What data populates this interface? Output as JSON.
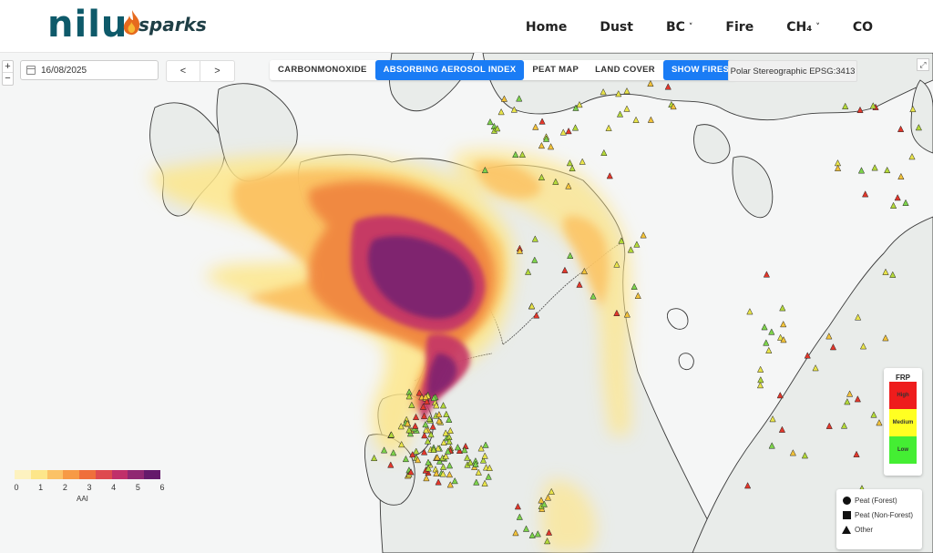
{
  "header": {
    "logo_main": "nilu",
    "logo_sub": "sparks",
    "nav": [
      {
        "label": "Home",
        "dropdown": false
      },
      {
        "label": "Dust",
        "dropdown": false
      },
      {
        "label": "BC",
        "dropdown": true
      },
      {
        "label": "Fire",
        "dropdown": false
      },
      {
        "label": "CH₄",
        "dropdown": true
      },
      {
        "label": "CO",
        "dropdown": false
      }
    ]
  },
  "controls": {
    "zoom_in": "+",
    "zoom_out": "−",
    "date_value": "16/08/2025",
    "prev_label": "<",
    "next_label": ">",
    "layers": [
      {
        "label": "CARBONMONOXIDE",
        "active": false
      },
      {
        "label": "ABSORBING AEROSOL INDEX",
        "active": true
      },
      {
        "label": "PEAT MAP",
        "active": false
      },
      {
        "label": "LAND COVER",
        "active": false
      },
      {
        "label": "SHOW FIRES",
        "active": true
      }
    ],
    "projection": "Polar Stereographic EPSG:3413",
    "expand_icon": "expand-icon"
  },
  "frp_legend": {
    "title": "FRP",
    "levels": [
      {
        "label": "High",
        "color": "#ee1c1c"
      },
      {
        "label": "Medium",
        "color": "#ffff22"
      },
      {
        "label": "Low",
        "color": "#44ee33"
      }
    ]
  },
  "marker_legend": [
    {
      "label": "Peat (Forest)",
      "shape": "circle"
    },
    {
      "label": "Peat (Non-Forest)",
      "shape": "square"
    },
    {
      "label": "Other",
      "shape": "triangle"
    }
  ],
  "aai_legend": {
    "label": "AAI",
    "ticks": [
      "0",
      "1",
      "2",
      "3",
      "4",
      "5",
      "6"
    ],
    "colors": [
      "#fdf2c0",
      "#fde68a",
      "#fbc266",
      "#f79a45",
      "#ef6f3b",
      "#de4a4f",
      "#c0306a",
      "#902872",
      "#651a6b"
    ]
  },
  "colors": {
    "accent": "#1a7cf5",
    "water": "#f5f6f6",
    "land": "#e8ece9",
    "border": "#3a3a3a"
  }
}
